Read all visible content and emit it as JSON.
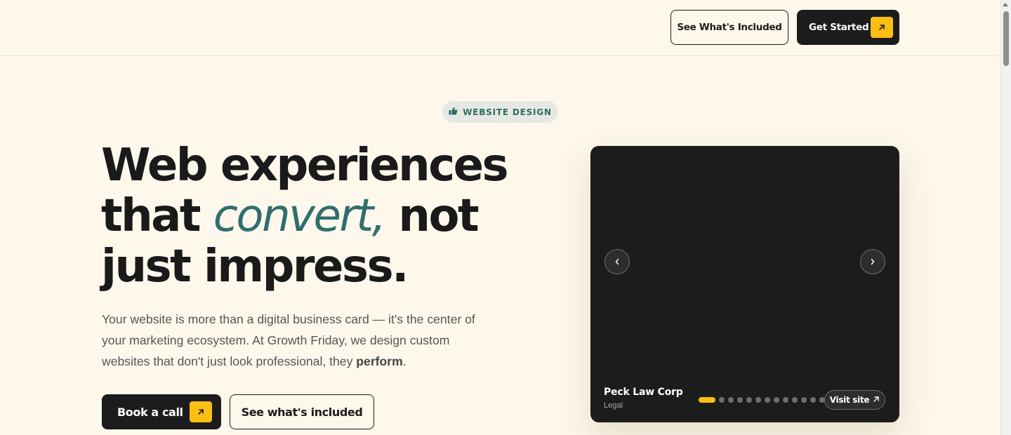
{
  "header": {
    "included_button_label": "See What's Included",
    "get_started_label": "Get Started"
  },
  "hero": {
    "badge_label": "WEBSITE DESIGN",
    "headline": {
      "line1": "Web experiences",
      "line2_start": "that ",
      "line2_accent": "convert,",
      "line2_end": " not",
      "line3": "just impress."
    },
    "lede_text": "Your website is more than a digital business card — it's the center of your marketing ecosystem. At Growth Friday, we design custom websites that don't just look professional, they ",
    "lede_emphasis": "perform",
    "lede_end": ".",
    "book_call_label": "Book a call",
    "see_included_label": "See what's included"
  },
  "showcase": {
    "client_name": "Peck Law Corp",
    "client_category": "Legal",
    "visit_label": "Visit site",
    "slide_count": 13,
    "active_slide": 1
  },
  "colors": {
    "background": "#fdf8eb",
    "accent_yellow": "#fbbf13",
    "accent_teal": "#2f6e6e",
    "dark": "#1c1c1c"
  },
  "icons": {
    "badge": "thumbs-up-icon",
    "cta_arrow": "arrow-up-right-icon",
    "prev": "chevron-left-icon",
    "next": "chevron-right-icon"
  }
}
